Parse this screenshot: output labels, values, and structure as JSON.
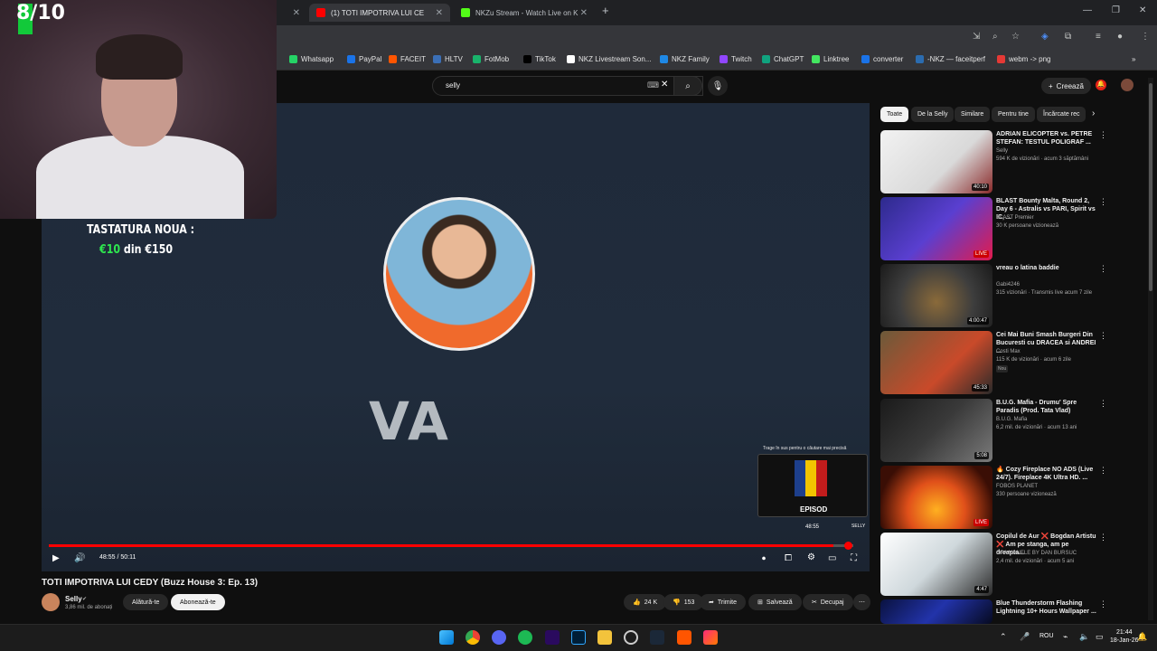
{
  "browser": {
    "tabs": [
      {
        "label": "",
        "active": false
      },
      {
        "label": "(1) TOTI IMPOTRIVA LUI CE",
        "active": true
      },
      {
        "label": "NKZu Stream - Watch Live on K",
        "active": false
      }
    ],
    "new_tab": "+",
    "window_controls": [
      "—",
      "❐",
      "✕"
    ],
    "bookmarks": [
      "Whatsapp",
      "PayPal",
      "FACEIT",
      "HLTV",
      "FotMob",
      "TikTok",
      "NKZ Livestream Son...",
      "NKZ Family",
      "Twitch",
      "ChatGPT",
      "Linktree",
      "converter",
      "-NKZ — faceitperf",
      "webm -> png"
    ],
    "bookmark_colors": [
      "#25d366",
      "#1a73e8",
      "#ff5500",
      "#3b6fb6",
      "#19b36b",
      "#000000",
      "#ffffff",
      "#1e88e5",
      "#9146ff",
      "#10a37f",
      "#43e660",
      "#1a73e8",
      "#2b6cb0",
      "#e53935"
    ]
  },
  "youtube": {
    "search_value": "selly",
    "create_label": "Creează",
    "video_title": "TOTI IMPOTRIVA LUI CEDY (Buzz House 3: Ep. 13)",
    "channel": {
      "name": "Selly",
      "subs": "3,86 mil. de abonați"
    },
    "join_label": "Alătură-te",
    "subscribe_label": "Abonează-te",
    "actions": {
      "likes": "24 K",
      "dislikes": "153",
      "share": "Trimite",
      "save": "Salvează",
      "clip": "Decupaj"
    },
    "player": {
      "overlay_text": "VA",
      "time": "48:55 / 50:11",
      "progress": 0.975,
      "preview_hint": "Trage în sus pentru o căutare mai precisă",
      "preview_time": "48:55",
      "preview_label": "EPISOD",
      "preview_brand": "SELLY"
    }
  },
  "overlay": {
    "rating": "8/10",
    "promo_title": "TASTATURA NOUA :",
    "promo_current": "€10",
    "promo_rest": " din €150"
  },
  "sidebar": {
    "chips": [
      {
        "label": "Toate",
        "active": true
      },
      {
        "label": "De la Selly",
        "active": false
      },
      {
        "label": "Similare",
        "active": false
      },
      {
        "label": "Pentru tine",
        "active": false
      },
      {
        "label": "Încărcate rec",
        "active": false
      }
    ],
    "items": [
      {
        "title": "ADRIAN ELICOPTER vs. PETRE STEFAN: TESTUL POLIGRAF ...",
        "channel": "Selly",
        "meta": "594 K de vizionări · acum 3 săptămâni",
        "badge": "",
        "duration": "40:10",
        "live": false,
        "bg": "linear-gradient(135deg,#f2f2f2,#d9d9d9 60%,#8a2a2a)"
      },
      {
        "title": "BLAST Bounty Malta, Round 2, Day 6 - Astralis vs PARI, Spirit vs IC, ...",
        "channel": "BLAST Premier",
        "meta": "30 K persoane vizionează",
        "badge": "",
        "duration": "LIVE",
        "live": true,
        "bg": "linear-gradient(135deg,#2d2a8c,#5a3fd0 50%,#e21b4d)"
      },
      {
        "title": "vreau o latina baddie",
        "channel": "Gabi4246",
        "meta": "315 vizionări · Transmis live acum 7 zile",
        "badge": "",
        "duration": "4:00:47",
        "live": false,
        "bg": "radial-gradient(circle at 50% 60%,#8a6a3a,#3d3d3d 55%,#1a1a1a)"
      },
      {
        "title": "Cei Mai Buni Smash Burgeri Din Bucuresti cu DRACEA si ANDREI ...",
        "channel": "Costi Max",
        "meta": "115 K de vizionări · acum 6 zile",
        "badge": "Nou",
        "duration": "45:33",
        "live": false,
        "bg": "linear-gradient(135deg,#6b5a3a,#c94a2a 60%,#2a2a2a)"
      },
      {
        "title": "B.U.G. Mafia - Drumu' Spre Paradis (Prod. Tata Vlad)",
        "channel": "B.U.G. Mafia",
        "meta": "6,2 mil. de vizionări · acum 13 ani",
        "badge": "",
        "duration": "5:08",
        "live": false,
        "bg": "linear-gradient(135deg,#1a1a1a,#3a3a3a 50%,#7a7a7a)"
      },
      {
        "title": "🔥 Cozy Fireplace NO ADS (Live 24/7). Fireplace 4K Ultra HD. ...",
        "channel": "FOBOS PLANET",
        "meta": "330 persoane vizionează",
        "badge": "",
        "duration": "LIVE",
        "live": true,
        "bg": "radial-gradient(circle at 50% 70%,#ffb020,#e0501a 40%,#3a0e05 80%)"
      },
      {
        "title": "Copilul de Aur ❌ Bogdan Artistu ❌ Am pe stanga, am pe dreapta...",
        "channel": "OPA MANELE BY DAN BURSUC",
        "meta": "2,4 mil. de vizionări · acum 5 ani",
        "badge": "",
        "duration": "4:47",
        "live": false,
        "bg": "linear-gradient(135deg,#ffffff,#cfd8dc 50%,#2a2a2a)"
      },
      {
        "title": "Blue Thunderstorm Flashing Lightning 10+ Hours Wallpaper ...",
        "channel": "",
        "meta": "",
        "badge": "",
        "duration": "",
        "live": false,
        "bg": "linear-gradient(135deg,#0a1240,#2233aa 50%,#060a20)"
      }
    ]
  },
  "taskbar": {
    "lang": "ROU",
    "time": "21:44",
    "date": "18-Jan-26"
  }
}
